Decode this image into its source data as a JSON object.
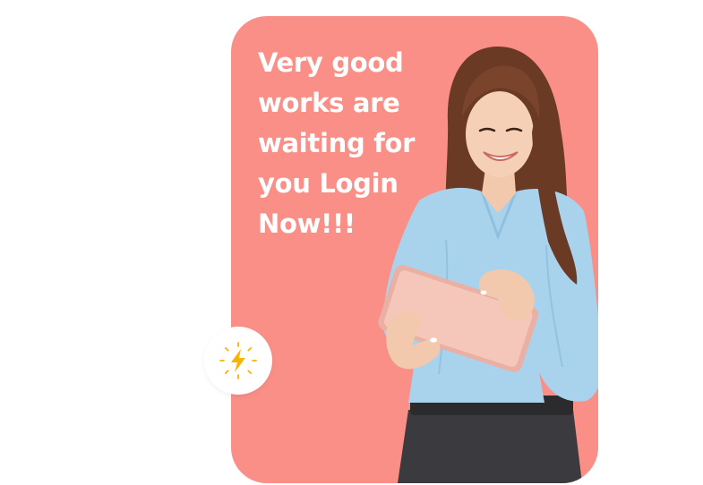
{
  "hero": {
    "headline": "Very good works are waiting for you Login Now!!!"
  },
  "badge": {
    "icon": "lightning-bolt-icon",
    "color": "#f7b500"
  },
  "colors": {
    "card_background": "#fa8f87",
    "headline_text": "#ffffff",
    "page_background": "#ffffff"
  },
  "illustration": {
    "subject": "woman-using-tablet"
  }
}
